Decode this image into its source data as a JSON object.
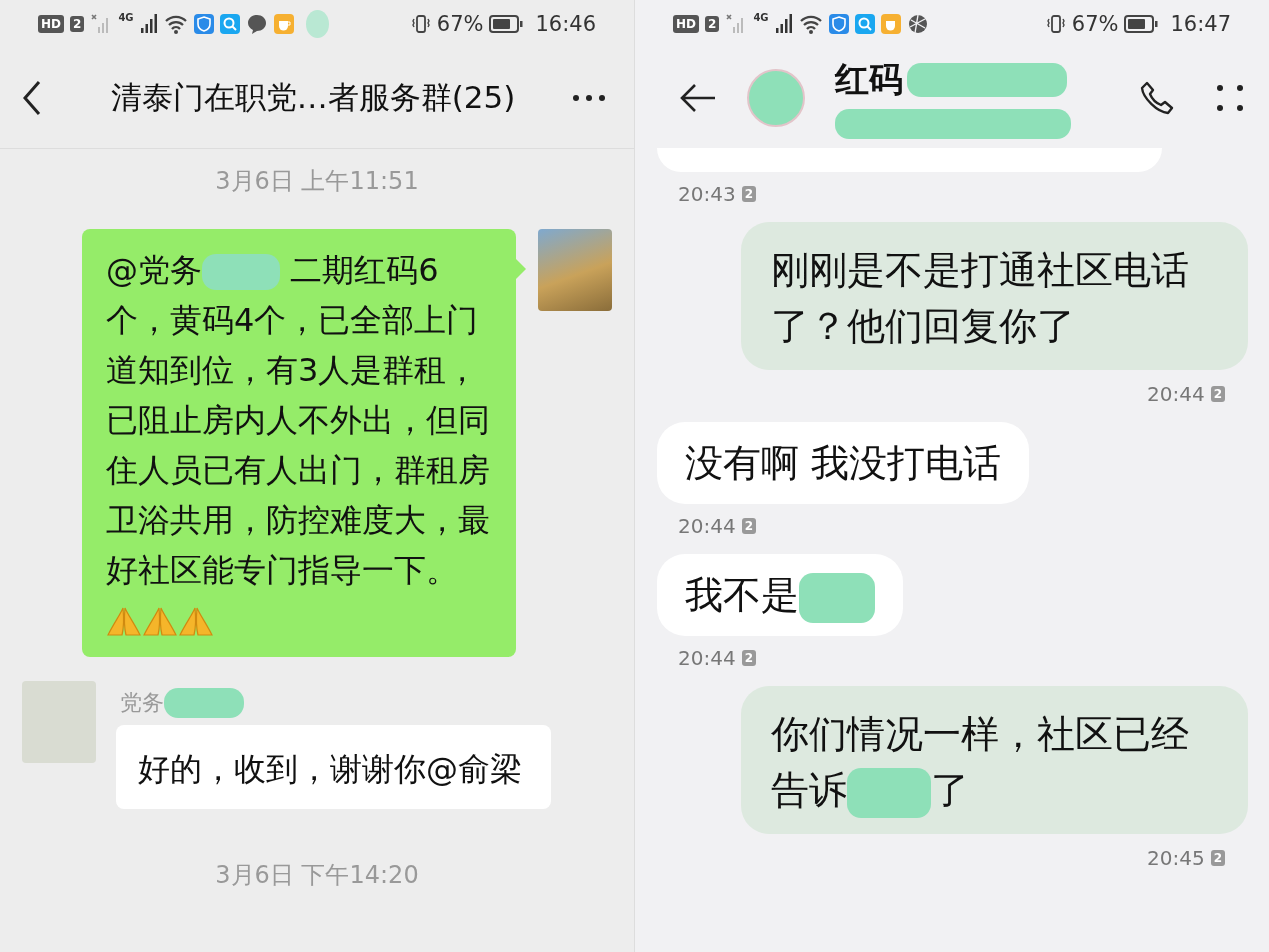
{
  "left_screen": {
    "status_bar": {
      "hd": "HD",
      "sim": "2",
      "network": "4G",
      "redacted": true,
      "battery": "67%",
      "time": "16:46"
    },
    "header": {
      "title": "清泰门在职党…者服务群(25)"
    },
    "messages": [
      {
        "kind": "timestamp",
        "text": "3月6日 上午11:51"
      },
      {
        "kind": "outgoing",
        "parts": [
          {
            "kind": "text",
            "text": "@党务"
          },
          {
            "kind": "redacted"
          },
          {
            "kind": "text",
            "text": " 二期红码6"
          },
          {
            "kind": "text_block",
            "text": "个，黄码4个，已全部上门道知到位，有3人是群租，已阻止房内人不外出，但同住人员已有人出门，群租房卫浴共用，防控难度大，最好社区能专门指导一下。"
          },
          {
            "kind": "pray"
          },
          {
            "kind": "pray"
          },
          {
            "kind": "pray"
          }
        ]
      },
      {
        "kind": "incoming",
        "sender": [
          {
            "kind": "text",
            "text": "党务"
          },
          {
            "kind": "redacted"
          }
        ],
        "parts": [
          {
            "kind": "text",
            "text": "好的，收到，谢谢你@俞梁"
          }
        ]
      },
      {
        "kind": "timestamp",
        "text": "3月6日 下午14:20"
      }
    ]
  },
  "right_screen": {
    "status_bar": {
      "hd": "HD",
      "sim": "2",
      "network": "4G",
      "battery": "67%",
      "time": "16:47"
    },
    "header": {
      "name": "红码"
    },
    "messages": [
      {
        "kind": "cut_incoming"
      },
      {
        "kind": "time_in",
        "text": "20:43",
        "sim": "2"
      },
      {
        "kind": "outgoing",
        "parts": [
          {
            "kind": "text",
            "text": "刚刚是不是打通社区电话了？他们回复你了"
          }
        ]
      },
      {
        "kind": "time_out",
        "text": "20:44",
        "sim": "2"
      },
      {
        "kind": "incoming",
        "parts": [
          {
            "kind": "text",
            "text": "没有啊 我没打电话"
          }
        ]
      },
      {
        "kind": "time_in",
        "text": "20:44",
        "sim": "2"
      },
      {
        "kind": "incoming",
        "parts": [
          {
            "kind": "text",
            "text": "我不是"
          },
          {
            "kind": "redacted"
          }
        ]
      },
      {
        "kind": "time_in",
        "text": "20:44",
        "sim": "2"
      },
      {
        "kind": "outgoing",
        "parts": [
          {
            "kind": "text_block",
            "text": "你们情况一样，社区已经"
          },
          {
            "kind": "text",
            "text": "告诉"
          },
          {
            "kind": "redacted"
          },
          {
            "kind": "text",
            "text": "了"
          }
        ]
      },
      {
        "kind": "time_out",
        "text": "20:45",
        "sim": "2"
      }
    ]
  }
}
